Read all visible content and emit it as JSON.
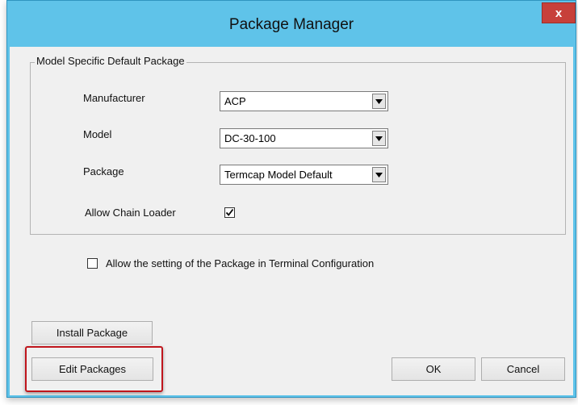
{
  "window": {
    "title": "Package Manager",
    "close_glyph": "x",
    "close_icon": "close-icon"
  },
  "group": {
    "legend": "Model Specific Default Package",
    "manufacturer": {
      "label": "Manufacturer",
      "value": "ACP"
    },
    "model": {
      "label": "Model",
      "value": "DC-30-100"
    },
    "package": {
      "label": "Package",
      "value": "Termcap Model Default"
    },
    "chain_loader": {
      "label": "Allow Chain Loader",
      "checked": true
    }
  },
  "terminal_config": {
    "label": "Allow the setting of the  Package in Terminal Configuration",
    "checked": false
  },
  "buttons": {
    "install": "Install Package",
    "edit": "Edit Packages",
    "ok": "OK",
    "cancel": "Cancel"
  },
  "colors": {
    "titlebar": "#5fc3e9",
    "close_button": "#c7403a",
    "highlight": "#c0161d"
  }
}
